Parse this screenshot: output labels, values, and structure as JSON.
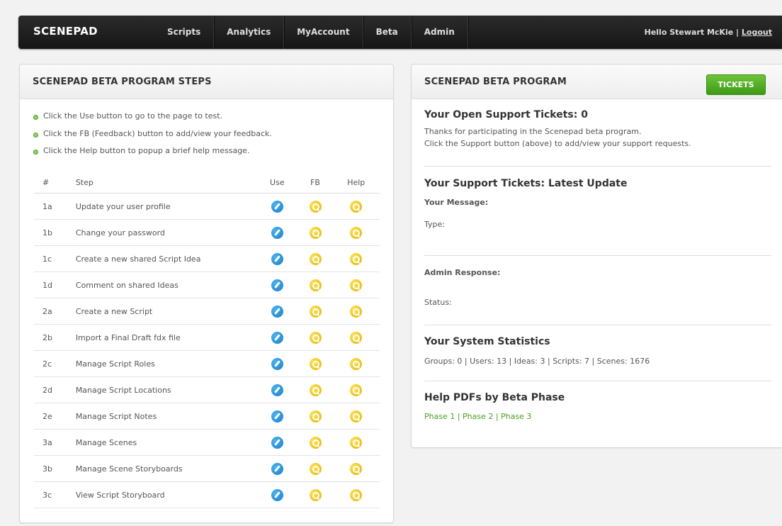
{
  "navbar": {
    "brand": "SCENEPAD",
    "links": [
      "Scripts",
      "Analytics",
      "MyAccount",
      "Beta",
      "Admin"
    ],
    "greeting": "Hello Stewart McKie",
    "separator": "|",
    "logout": "Logout"
  },
  "left_panel": {
    "title": "SCENEPAD BETA PROGRAM STEPS",
    "bullets": [
      "Click the Use button to go to the page to test.",
      "Click the FB (Feedback) button to add/view your feedback.",
      "Click the Help button to popup a brief help message."
    ],
    "table": {
      "headers": {
        "num": "#",
        "step": "Step",
        "use": "Use",
        "fb": "FB",
        "help": "Help"
      },
      "rows": [
        {
          "num": "1a",
          "step": "Update your user profile"
        },
        {
          "num": "1b",
          "step": "Change your password"
        },
        {
          "num": "1c",
          "step": "Create a new shared Script Idea"
        },
        {
          "num": "1d",
          "step": "Comment on shared Ideas"
        },
        {
          "num": "2a",
          "step": "Create a new Script"
        },
        {
          "num": "2b",
          "step": "Import a Final Draft fdx file"
        },
        {
          "num": "2c",
          "step": "Manage Script Roles"
        },
        {
          "num": "2d",
          "step": "Manage Script Locations"
        },
        {
          "num": "2e",
          "step": "Manage Script Notes"
        },
        {
          "num": "3a",
          "step": "Manage Scenes"
        },
        {
          "num": "3b",
          "step": "Manage Scene Storyboards"
        },
        {
          "num": "3c",
          "step": "View Script Storyboard"
        }
      ]
    }
  },
  "right_panel": {
    "title": "SCENEPAD BETA PROGRAM",
    "tickets_button": "TICKETS",
    "open_tickets": {
      "heading": "Your Open Support Tickets: 0",
      "line1": "Thanks for participating in the Scenepad beta program.",
      "line2": "Click the Support button (above) to add/view your support requests."
    },
    "latest_update": {
      "heading": "Your Support Tickets: Latest Update",
      "message_label": "Your Message:",
      "type_label": "Type:",
      "admin_response_label": "Admin Response:",
      "status_label": "Status:"
    },
    "stats": {
      "heading": "Your System Statistics",
      "text": "Groups: 0 | Users: 13 | Ideas: 3 | Scripts: 7 | Scenes: 1676"
    },
    "help_pdfs": {
      "heading": "Help PDFs by Beta Phase",
      "links": [
        "Phase 1",
        "Phase 2",
        "Phase 3"
      ],
      "separator": " | "
    }
  },
  "colors": {
    "navbar_bg": "#1e1e1e",
    "accent_green": "#4a9f1e",
    "button_green": "#4fae22",
    "edit_icon_blue": "#1b8fd6",
    "help_icon_yellow": "#f2c200"
  },
  "icons": {
    "use": "pencil-edit-icon",
    "fb": "magnifier-icon",
    "help": "magnifier-icon"
  }
}
